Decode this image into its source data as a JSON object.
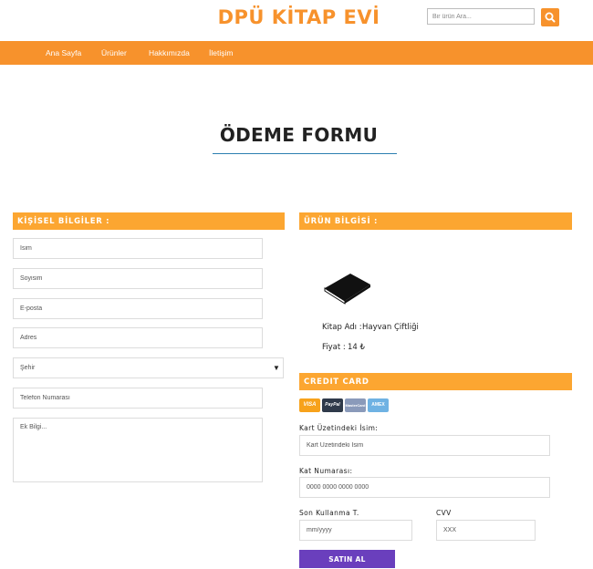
{
  "header": {
    "brand": "DPÜ KİTAP EVİ",
    "search_placeholder": "Bir ürün Ara..."
  },
  "nav": {
    "items": [
      {
        "label": "Ana Sayfa"
      },
      {
        "label": "Ürünler"
      },
      {
        "label": "Hakkımızda"
      },
      {
        "label": "İletişim"
      }
    ]
  },
  "page": {
    "title": "ÖDEME FORMU"
  },
  "personal": {
    "heading": "KİŞİSEL BİLGİLER :",
    "name_placeholder": "İsim",
    "surname_placeholder": "Soyisim",
    "email_placeholder": "E-posta",
    "address_placeholder": "Adres",
    "city_selected": "Şehir",
    "phone_placeholder": "Telefon Numarası",
    "notes_placeholder": "Ek Bilgi..."
  },
  "product": {
    "heading": "ÜRÜN BİLGİSİ :",
    "book_label": "Kitap Adı :",
    "book_name": "Hayvan Çiftliği",
    "price_label": "Fiyat :",
    "price": "14 ₺"
  },
  "credit_card": {
    "heading": "CREDIT CARD",
    "logos": [
      "VISA",
      "PayPal",
      "MasterCard",
      "AMEX"
    ],
    "holder_label": "Kart Üzetindeki İsim:",
    "holder_placeholder": "Kart Üzetindeki İsim",
    "number_label": "Kat Numarası:",
    "number_placeholder": "0000 0000 0000 0000",
    "expiry_label": "Son Kullanma T.",
    "expiry_placeholder": "mm/yyyy",
    "cvv_label": "CVV",
    "cvv_placeholder": "XXX",
    "submit_label": "SATIN AL"
  },
  "colors": {
    "accent": "#f7922c",
    "section_bar": "#fca631",
    "title_underline": "#2c7fb0",
    "submit": "#6a3fbd"
  }
}
